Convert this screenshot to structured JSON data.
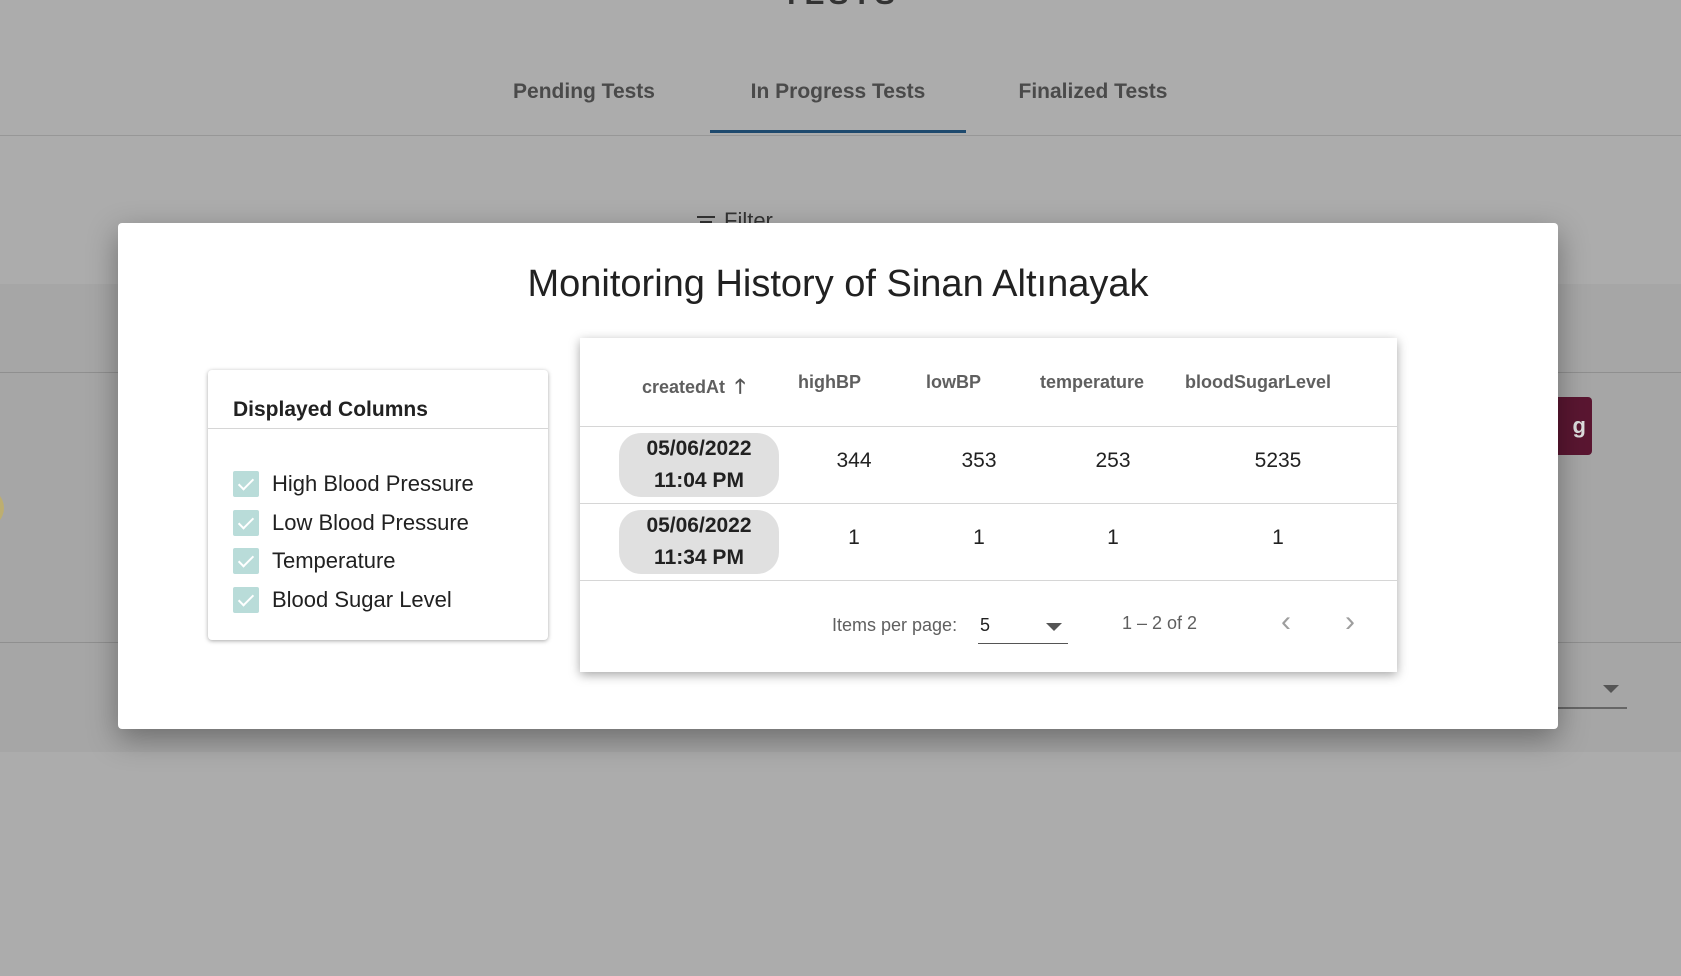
{
  "background": {
    "page_title": "TESTS",
    "tabs": [
      "Pending Tests",
      "In Progress Tests",
      "Finalized Tests"
    ],
    "active_tab": "In Progress Tests",
    "filter_label": "Filter",
    "side_button_label": "g"
  },
  "modal": {
    "title": "Monitoring History of Sinan Altınayak",
    "columns_card": {
      "heading": "Displayed Columns",
      "items": [
        {
          "label": "High Blood Pressure",
          "checked": true
        },
        {
          "label": "Low Blood Pressure",
          "checked": true
        },
        {
          "label": "Temperature",
          "checked": true
        },
        {
          "label": "Blood Sugar Level",
          "checked": true
        }
      ]
    },
    "table": {
      "headers": [
        "createdAt",
        "highBP",
        "lowBP",
        "temperature",
        "bloodSugarLevel"
      ],
      "sort_icon": "arrow-up-icon",
      "rows": [
        {
          "date": "05/06/2022",
          "time": "11:04 PM",
          "highBP": "344",
          "lowBP": "353",
          "temperature": "253",
          "bloodSugarLevel": "5235"
        },
        {
          "date": "05/06/2022",
          "time": "11:34 PM",
          "highBP": "1",
          "lowBP": "1",
          "temperature": "1",
          "bloodSugarLevel": "1"
        }
      ],
      "paginator": {
        "items_per_page_label": "Items per page:",
        "page_size": "5",
        "range": "1 – 2 of 2",
        "prev_icon": "chevron-left-icon",
        "next_icon": "chevron-right-icon"
      }
    }
  },
  "colors": {
    "accent_tab_ink": "#1e4a6e",
    "checkbox": "#b9dcd9",
    "button_bg": "#5a1631",
    "overlay": "#acacac"
  }
}
